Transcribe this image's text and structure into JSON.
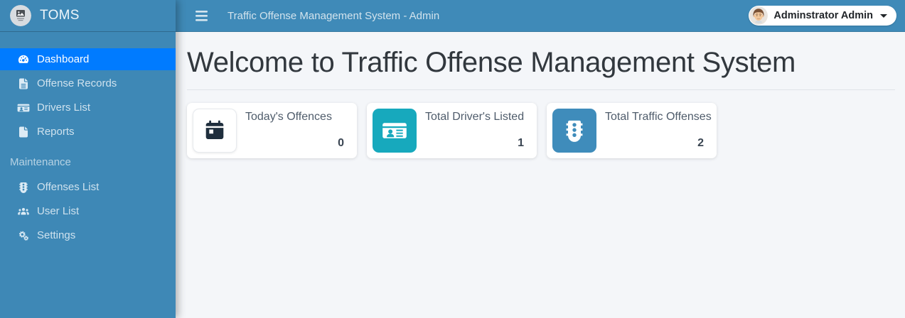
{
  "brand": {
    "name": "TOMS",
    "logo_icon": "image-placeholder-icon"
  },
  "navbar": {
    "title": "Traffic Offense Management System - Admin",
    "menu_icon": "bars-icon",
    "user_name": "Adminstrator Admin",
    "user_caret_icon": "caret-down-icon"
  },
  "sidebar": {
    "items": [
      {
        "label": "Dashboard",
        "icon": "gauge-icon",
        "active": true
      },
      {
        "label": "Offense Records",
        "icon": "file-lines-icon",
        "active": false
      },
      {
        "label": "Drivers List",
        "icon": "id-card-icon",
        "active": false
      },
      {
        "label": "Reports",
        "icon": "file-icon",
        "active": false
      }
    ],
    "section_label": "Maintenance",
    "maintenance_items": [
      {
        "label": "Offenses List",
        "icon": "traffic-light-icon",
        "active": false
      },
      {
        "label": "User List",
        "icon": "users-icon",
        "active": false
      },
      {
        "label": "Settings",
        "icon": "cogs-icon",
        "active": false
      }
    ]
  },
  "main": {
    "heading": "Welcome to Traffic Offense Management System",
    "cards": [
      {
        "title": "Today's Offences",
        "value": "0",
        "icon": "calendar-day-icon",
        "icon_bg": "#ffffff",
        "icon_color": "#1f2e3d"
      },
      {
        "title": "Total Driver's Listed",
        "value": "1",
        "icon": "id-card-icon",
        "icon_bg": "#17a9bd",
        "icon_color": "#ffffff"
      },
      {
        "title": "Total Traffic Offenses",
        "value": "2",
        "icon": "traffic-light-icon",
        "icon_bg": "#3f8cbb",
        "icon_color": "#ffffff"
      }
    ]
  },
  "colors": {
    "sidebar_bg": "#3e88b6",
    "navbar_bg": "#3f8ab8",
    "active_item_bg": "#007bff",
    "content_bg": "#f4f6f9",
    "heading_text": "#32383e",
    "card_icon_teal": "#17a9bd",
    "card_icon_blue": "#3f8cbb",
    "card_icon_dark": "#1f2e3d"
  }
}
